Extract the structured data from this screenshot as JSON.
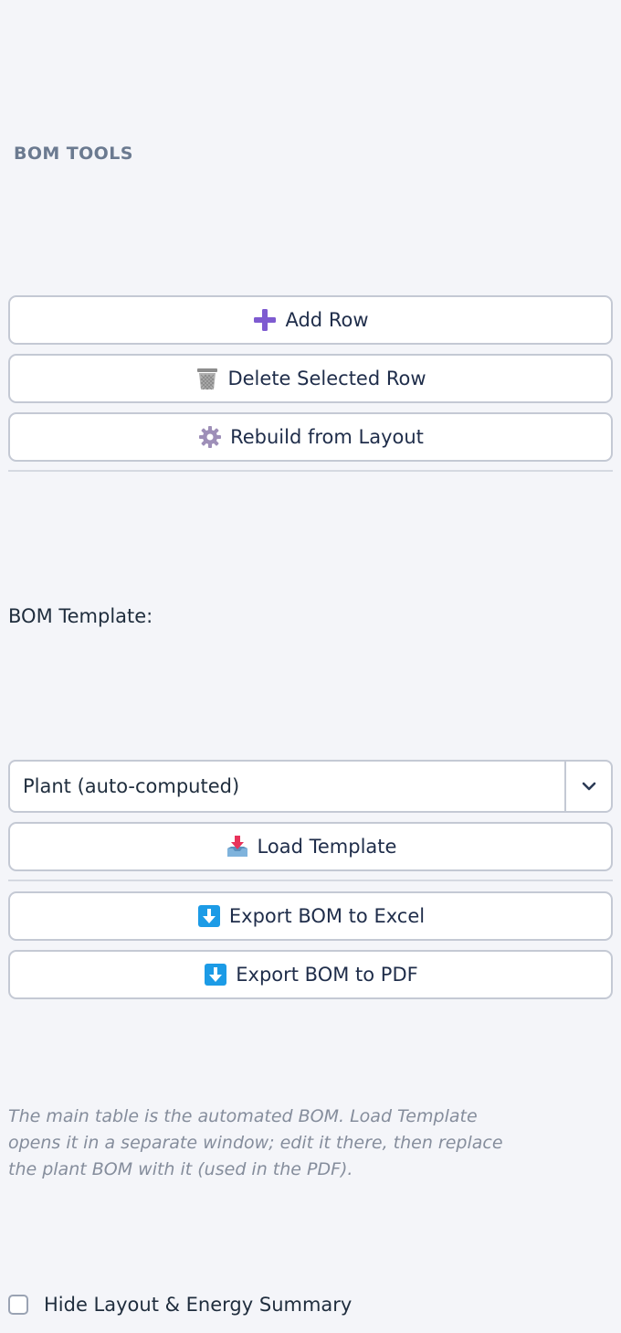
{
  "section_title": "BOM TOOLS",
  "buttons": {
    "add_row": "Add Row",
    "delete_row": "Delete Selected Row",
    "rebuild": "Rebuild from Layout",
    "load_template": "Load Template",
    "export_excel": "Export BOM to Excel",
    "export_pdf": "Export BOM to PDF"
  },
  "icons": {
    "add_row": "plus-icon",
    "delete_row": "wastebasket-icon",
    "rebuild": "gear-icon",
    "load_template": "inbox-tray-icon",
    "export_excel": "down-arrow-icon",
    "export_pdf": "down-arrow-icon"
  },
  "template": {
    "label": "BOM Template:",
    "selected": "Plant (auto-computed)"
  },
  "note": "The main table is the automated BOM. Load Template opens it in a separate window; edit it there, then replace the plant BOM with it (used in the PDF).",
  "hide_summary": {
    "label": "Hide Layout & Energy Summary",
    "checked": false
  },
  "colors": {
    "background": "#f4f5f9",
    "button_border": "#c4c9d4",
    "section_title": "#6b7a90",
    "plus_icon": "#7e5bd0",
    "download_icon": "#1c9be6",
    "note_text": "#858d9c"
  }
}
